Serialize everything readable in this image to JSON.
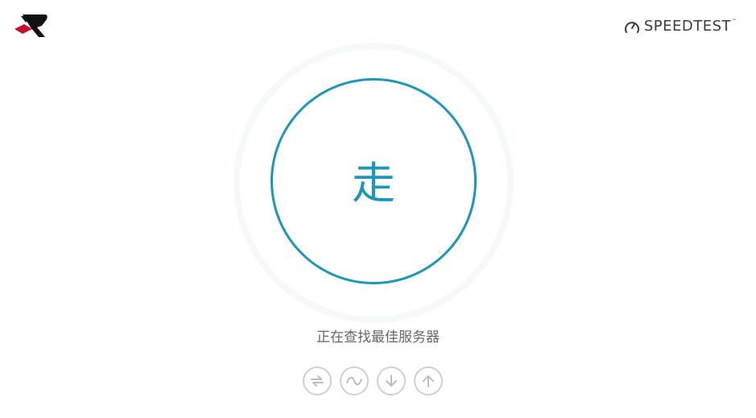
{
  "header": {
    "brand_name": "SPEEDTEST",
    "brand_tm": "™",
    "logo_icon": "red-black-r-logo-icon",
    "speedometer_icon": "gauge-icon"
  },
  "main": {
    "go_button_label": "走",
    "status_text": "正在查找最佳服务器"
  },
  "metrics": [
    {
      "name": "ping",
      "icon": "ping-arrows-icon"
    },
    {
      "name": "jitter",
      "icon": "wave-icon"
    },
    {
      "name": "download",
      "icon": "download-arrow-icon"
    },
    {
      "name": "upload",
      "icon": "upload-arrow-icon"
    }
  ],
  "colors": {
    "accent": "#1a97b9",
    "text_muted": "#666666",
    "icon_gray": "#cfcfcf",
    "logo_red": "#c8102e",
    "logo_black": "#111111"
  }
}
